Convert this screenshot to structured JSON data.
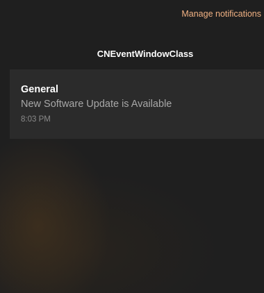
{
  "header": {
    "manage_label": "Manage notifications"
  },
  "group": {
    "app_name": "CNEventWindowClass"
  },
  "notification": {
    "title": "General",
    "message": "New Software Update is Available",
    "time": "8:03 PM"
  }
}
